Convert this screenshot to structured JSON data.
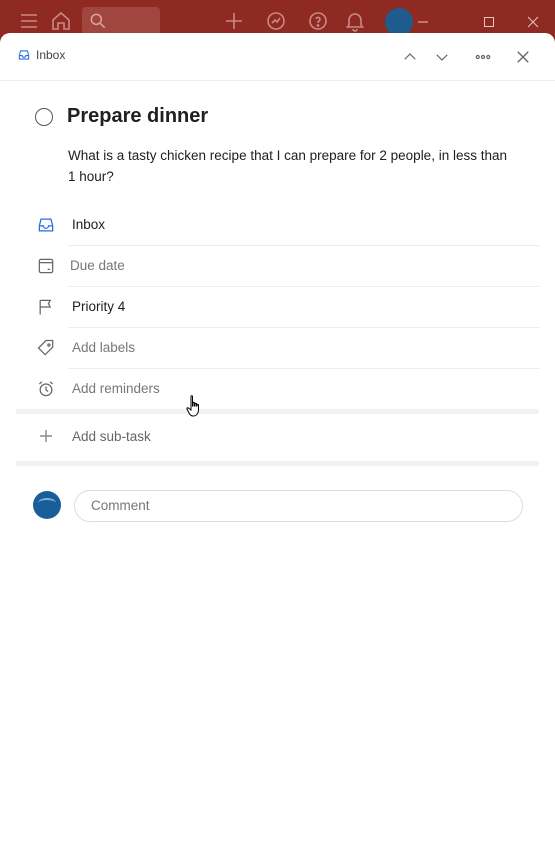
{
  "appbar": {
    "icons": [
      "menu-icon",
      "home-icon",
      "search-icon",
      "add-icon",
      "productivity-icon",
      "help-icon",
      "bell-icon",
      "avatar",
      "minimize-icon",
      "maximize-icon",
      "close-icon"
    ],
    "color": "#8e2a22"
  },
  "header": {
    "breadcrumb": "Inbox",
    "buttons": [
      "chevron-up-icon",
      "chevron-down-icon",
      "more-icon",
      "close-icon"
    ]
  },
  "task": {
    "title": "Prepare dinner",
    "description": "What is a tasty chicken recipe that I can prepare for 2 people, in less than 1 hour?"
  },
  "attributes": [
    {
      "icon": "inbox-icon",
      "label": "Inbox",
      "muted": false
    },
    {
      "icon": "calendar-icon",
      "label": "Due date",
      "muted": true
    },
    {
      "icon": "flag-icon",
      "label": "Priority 4",
      "muted": false
    },
    {
      "icon": "tag-icon",
      "label": "Add labels",
      "muted": true
    },
    {
      "icon": "alarm-icon",
      "label": "Add reminders",
      "muted": true
    }
  ],
  "subtask": {
    "label": "Add sub-task"
  },
  "comment": {
    "placeholder": "Comment"
  },
  "colors": {
    "accent": "#246fe0",
    "brand": "#db4c3f"
  }
}
